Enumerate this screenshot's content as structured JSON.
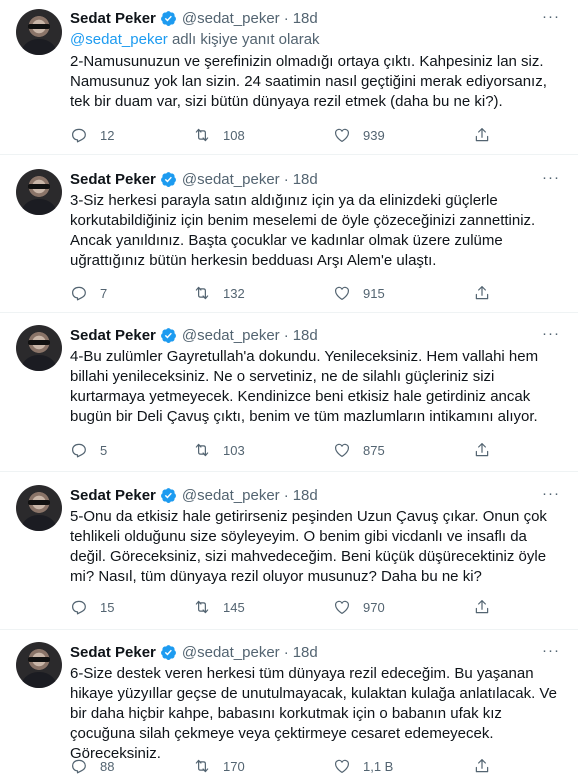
{
  "author": {
    "name": "Sedat Peker",
    "handle": "@sedat_peker",
    "time": "18d",
    "separator": "·",
    "more": "···"
  },
  "replying": {
    "mention": "@sedat_peker",
    "suffix": " adlı kişiye yanıt olarak"
  },
  "tweets": [
    {
      "text": "2-Namusunuzun ve şerefinizin olmadığı ortaya çıktı. Kahpesiniz lan siz. Namusunuz yok lan sizin. 24 saatimin nasıl geçtiğini merak ediyorsanız, tek bir duam var, sizi bütün dünyaya rezil etmek (daha bu ne ki?).",
      "replies": "12",
      "retweets": "108",
      "likes": "939"
    },
    {
      "text": "3-Siz herkesi parayla satın aldığınız için ya da elinizdeki güçlerle korkutabildiğiniz için benim meselemi de öyle çözeceğinizi zannettiniz. Ancak yanıldınız. Başta çocuklar ve kadınlar olmak üzere zulüme uğrattığınız bütün herkesin bedduası Arşı Alem'e ulaştı.",
      "replies": "7",
      "retweets": "132",
      "likes": "915"
    },
    {
      "text": "4-Bu zulümler Gayretullah'a dokundu. Yenileceksiniz. Hem vallahi hem billahi yenileceksiniz. Ne o servetiniz, ne de silahlı güçleriniz sizi kurtarmaya yetmeyecek. Kendinizce beni etkisiz hale getirdiniz ancak bugün bir Deli Çavuş çıktı, benim ve tüm mazlumların intikamını alıyor.",
      "replies": "5",
      "retweets": "103",
      "likes": "875"
    },
    {
      "text": "5-Onu da etkisiz hale getirirseniz peşinden Uzun Çavuş çıkar. Onun çok tehlikeli olduğunu size söyleyeyim. O benim gibi vicdanlı ve insaflı da değil. Göreceksiniz, sizi mahvedeceğim. Beni küçük düşürecektiniz öyle mi? Nasıl, tüm dünyaya rezil oluyor musunuz? Daha bu ne ki?",
      "replies": "15",
      "retweets": "145",
      "likes": "970"
    },
    {
      "text": "6-Size destek veren herkesi tüm dünyaya rezil edeceğim. Bu yaşanan hikaye yüzyıllar geçse de unutulmayacak, kulaktan kulağa anlatılacak. Ve bir daha hiçbir kahpe, babasını korkutmak için o babanın ufak kız çocuğuna silah çekmeye veya çektirmeye cesaret edemeyecek. Göreceksiniz.",
      "replies": "88",
      "retweets": "170",
      "likes": "1,1 B"
    }
  ],
  "colors": {
    "text": "#0f1419",
    "secondary": "#536471",
    "link": "#1d9bf0",
    "verified": "#1d9bf0",
    "divider": "#eff3f4"
  },
  "icons": [
    "verified-badge-icon",
    "reply-icon",
    "retweet-icon",
    "like-icon",
    "share-icon",
    "more-icon"
  ]
}
